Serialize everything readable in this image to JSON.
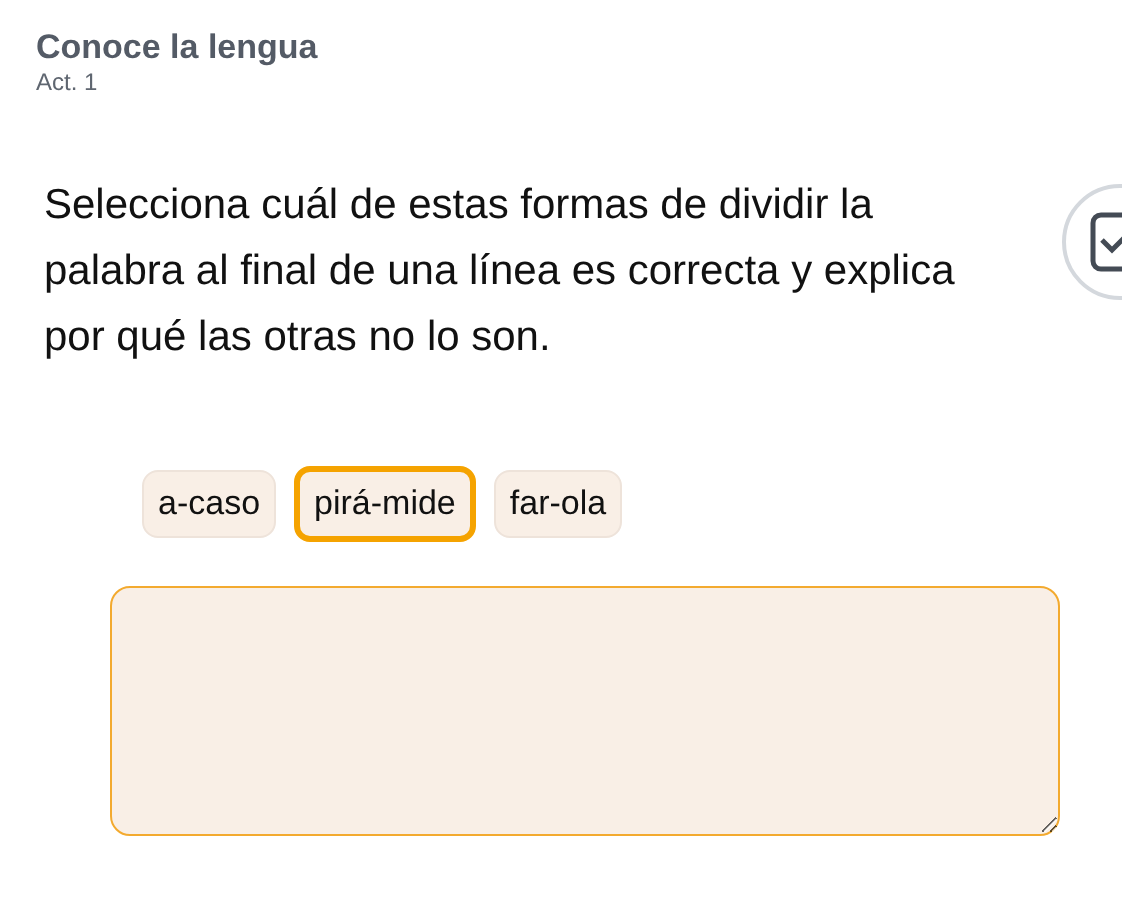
{
  "header": {
    "title": "Conoce la lengua",
    "subtitle": "Act. 1"
  },
  "question": "Selecciona cuál de estas formas de dividir la palabra al final de una línea es correcta y explica por qué las otras no lo son.",
  "options": [
    {
      "label": "a-caso",
      "selected": false
    },
    {
      "label": "pirá-mide",
      "selected": true
    },
    {
      "label": "far-ola",
      "selected": false
    }
  ]
}
